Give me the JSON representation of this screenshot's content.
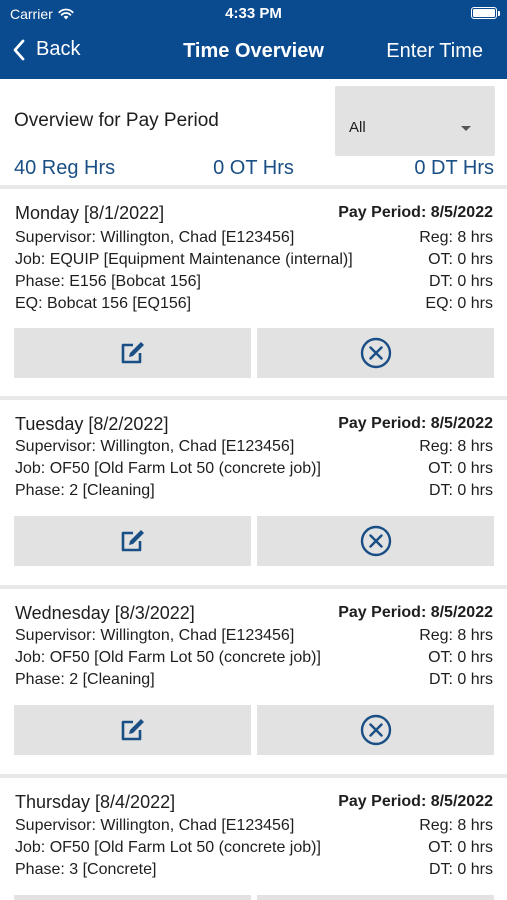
{
  "status": {
    "carrier": "Carrier",
    "time": "4:33 PM"
  },
  "nav": {
    "back_label": "Back",
    "title": "Time Overview",
    "enter_label": "Enter Time"
  },
  "overview": {
    "label": "Overview for Pay Period",
    "filter_value": "All",
    "reg_hrs": "40 Reg Hrs",
    "ot_hrs": "0 OT Hrs",
    "dt_hrs": "0 DT Hrs"
  },
  "colors": {
    "header_bg": "#0a4a8f",
    "accent": "#1a4f85",
    "button_bg": "#e2e2e2"
  },
  "entries": [
    {
      "day": "Monday [8/1/2022]",
      "pay_period": "Pay Period: 8/5/2022",
      "rows": [
        {
          "left": "Supervisor: Willington, Chad [E123456]",
          "right": "Reg: 8 hrs"
        },
        {
          "left": "Job: EQUIP [Equipment Maintenance (internal)]",
          "right": "OT: 0 hrs"
        },
        {
          "left": "Phase: E156 [Bobcat 156]",
          "right": "DT: 0 hrs"
        },
        {
          "left": "EQ: Bobcat 156 [EQ156]",
          "right": "EQ: 0 hrs"
        }
      ]
    },
    {
      "day": "Tuesday [8/2/2022]",
      "pay_period": "Pay Period: 8/5/2022",
      "rows": [
        {
          "left": "Supervisor: Willington, Chad [E123456]",
          "right": "Reg: 8 hrs"
        },
        {
          "left": "Job: OF50 [Old Farm Lot 50 (concrete job)]",
          "right": "OT: 0 hrs"
        },
        {
          "left": "Phase: 2 [Cleaning]",
          "right": "DT: 0 hrs"
        }
      ]
    },
    {
      "day": "Wednesday [8/3/2022]",
      "pay_period": "Pay Period: 8/5/2022",
      "rows": [
        {
          "left": "Supervisor: Willington, Chad [E123456]",
          "right": "Reg: 8 hrs"
        },
        {
          "left": "Job: OF50 [Old Farm Lot 50 (concrete job)]",
          "right": "OT: 0 hrs"
        },
        {
          "left": "Phase: 2 [Cleaning]",
          "right": "DT: 0 hrs"
        }
      ]
    },
    {
      "day": "Thursday [8/4/2022]",
      "pay_period": "Pay Period: 8/5/2022",
      "rows": [
        {
          "left": "Supervisor: Willington, Chad [E123456]",
          "right": "Reg: 8 hrs"
        },
        {
          "left": "Job: OF50 [Old Farm Lot 50 (concrete job)]",
          "right": "OT: 0 hrs"
        },
        {
          "left": "Phase: 3 [Concrete]",
          "right": "DT: 0 hrs"
        }
      ]
    }
  ],
  "icons": {
    "edit": "edit-icon",
    "delete": "delete-circle-x-icon"
  }
}
